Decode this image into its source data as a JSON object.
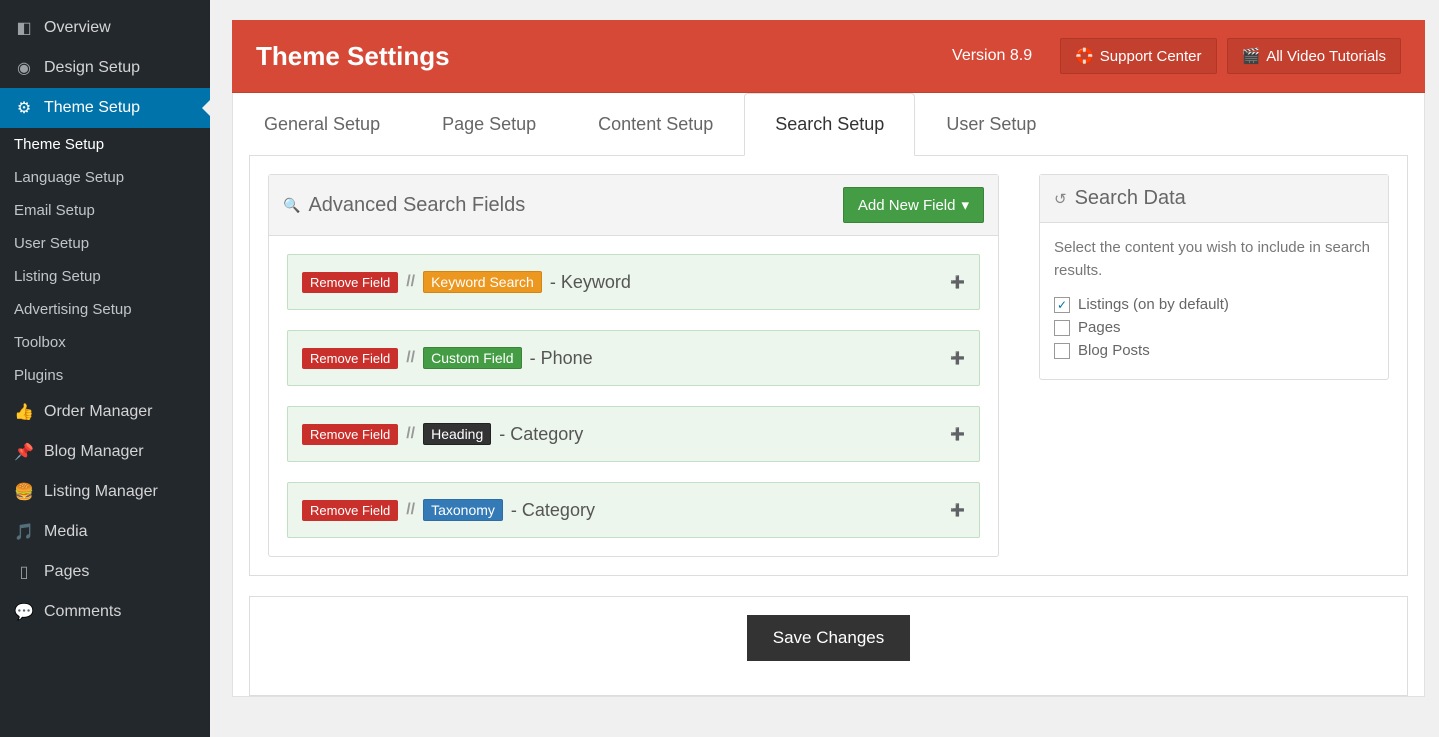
{
  "sidebar": {
    "main": [
      {
        "icon": "overview",
        "label": "Overview"
      },
      {
        "icon": "design",
        "label": "Design Setup"
      },
      {
        "icon": "gear",
        "label": "Theme Setup",
        "active": true
      },
      {
        "icon": "order",
        "label": "Order Manager"
      },
      {
        "icon": "pin",
        "label": "Blog Manager"
      },
      {
        "icon": "listing",
        "label": "Listing Manager"
      },
      {
        "icon": "media",
        "label": "Media"
      },
      {
        "icon": "pages",
        "label": "Pages"
      },
      {
        "icon": "comments",
        "label": "Comments"
      }
    ],
    "sub": [
      {
        "label": "Theme Setup",
        "current": true
      },
      {
        "label": "Language Setup"
      },
      {
        "label": "Email Setup"
      },
      {
        "label": "User Setup"
      },
      {
        "label": "Listing Setup"
      },
      {
        "label": "Advertising Setup"
      },
      {
        "label": "Toolbox"
      },
      {
        "label": "Plugins"
      }
    ]
  },
  "header": {
    "title": "Theme Settings",
    "version": "Version 8.9",
    "support": "Support Center",
    "tutorials": "All Video Tutorials"
  },
  "tabs": [
    {
      "label": "General Setup"
    },
    {
      "label": "Page Setup"
    },
    {
      "label": "Content Setup"
    },
    {
      "label": "Search Setup",
      "active": true
    },
    {
      "label": "User Setup"
    }
  ],
  "search_panel": {
    "title": "Advanced Search Fields",
    "add_btn": "Add New Field",
    "remove": "Remove Field",
    "fields": [
      {
        "tag": "Keyword Search",
        "tagClass": "orange",
        "name": "Keyword"
      },
      {
        "tag": "Custom Field",
        "tagClass": "green",
        "name": "Phone"
      },
      {
        "tag": "Heading",
        "tagClass": "dark",
        "name": "Category"
      },
      {
        "tag": "Taxonomy",
        "tagClass": "blue",
        "name": "Category"
      }
    ]
  },
  "search_data": {
    "title": "Search Data",
    "desc": "Select the content you wish to include in search results.",
    "options": [
      {
        "label": "Listings (on by default)",
        "checked": true
      },
      {
        "label": "Pages",
        "checked": false
      },
      {
        "label": "Blog Posts",
        "checked": false
      }
    ]
  },
  "save": "Save Changes"
}
